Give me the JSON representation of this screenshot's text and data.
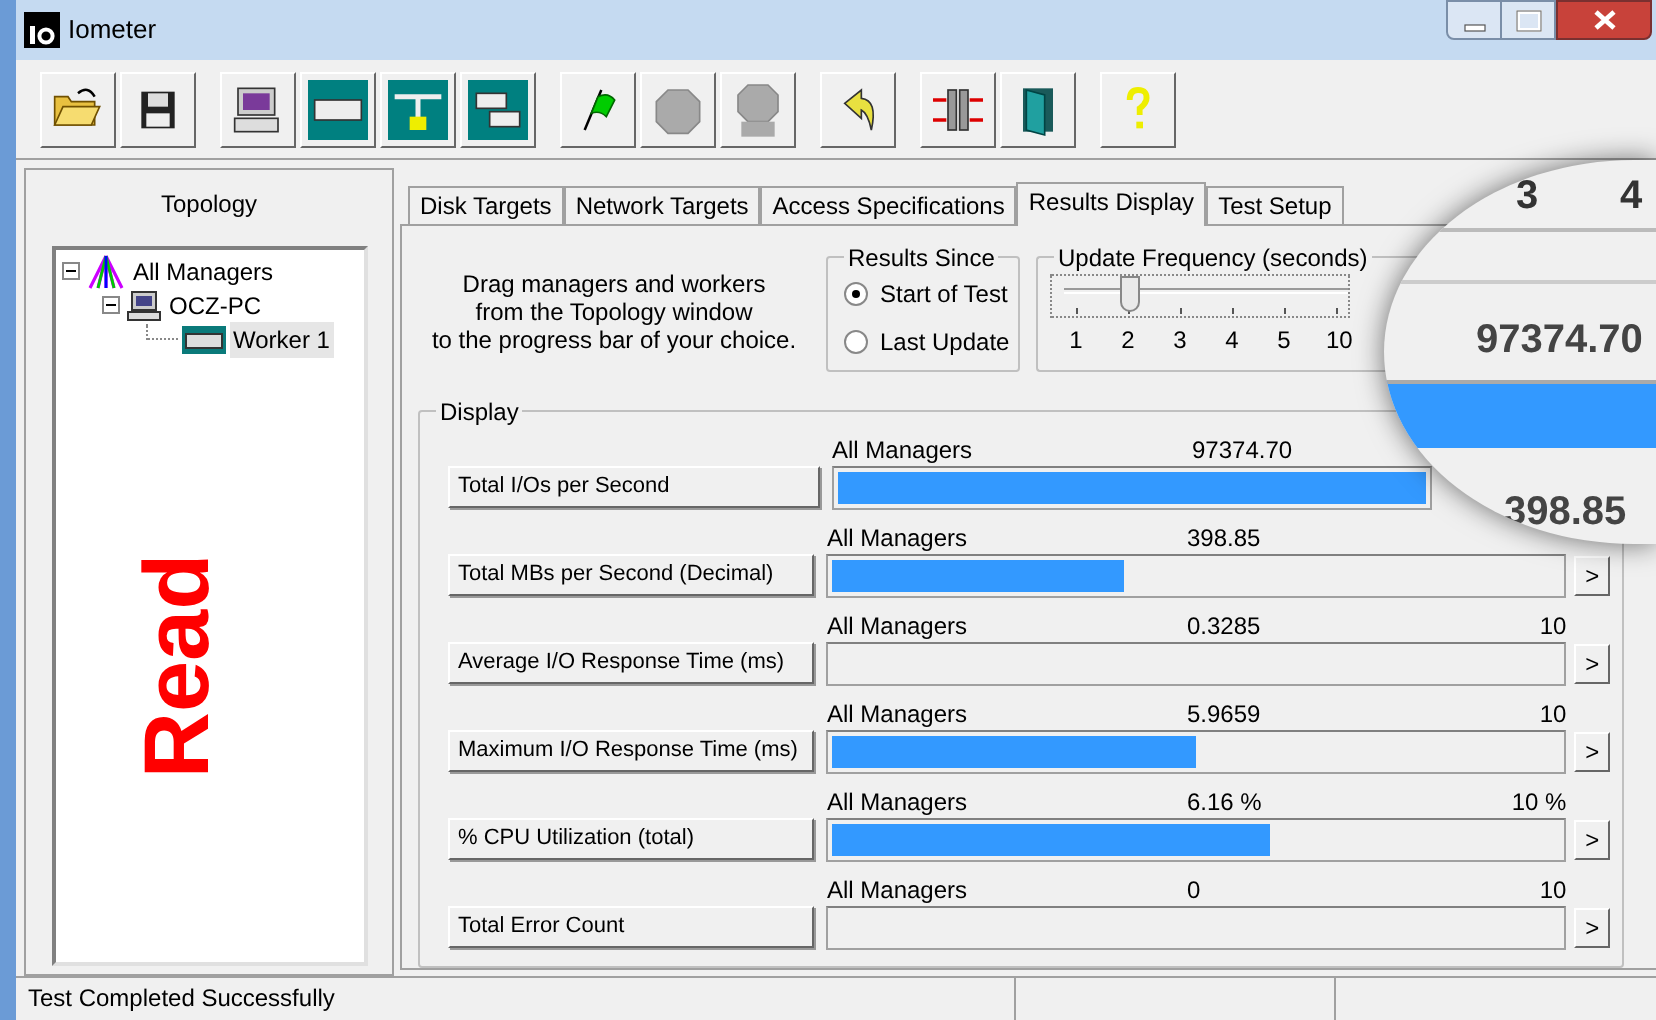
{
  "window": {
    "title": "Iometer"
  },
  "topology": {
    "title": "Topology",
    "tree": [
      {
        "label": "All Managers",
        "kind": "managers",
        "expanded": true,
        "selected": false,
        "children": [
          {
            "label": "OCZ-PC",
            "kind": "manager",
            "expanded": true,
            "selected": false,
            "children": [
              {
                "label": "Worker 1",
                "kind": "worker",
                "selected": true
              }
            ]
          }
        ]
      }
    ]
  },
  "overlay_label": "Read",
  "tabs": [
    {
      "label": "Disk Targets",
      "selected": false
    },
    {
      "label": "Network Targets",
      "selected": false
    },
    {
      "label": "Access Specifications",
      "selected": false
    },
    {
      "label": "Results Display",
      "selected": true
    },
    {
      "label": "Test Setup",
      "selected": false
    }
  ],
  "drag_hint": "Drag managers and workers\nfrom the Topology window\nto the progress bar of your choice.",
  "results_since": {
    "title": "Results Since",
    "options": [
      {
        "label": "Start of Test",
        "selected": true
      },
      {
        "label": "Last Update",
        "selected": false
      }
    ]
  },
  "update_frequency": {
    "title": "Update Frequency (seconds)",
    "ticks": [
      {
        "label": "1",
        "selected": false
      },
      {
        "label": "2",
        "selected": true
      },
      {
        "label": "3",
        "selected": false
      },
      {
        "label": "4",
        "selected": false
      },
      {
        "label": "5",
        "selected": false
      },
      {
        "label": "10",
        "selected": false
      }
    ]
  },
  "display": {
    "title": "Display",
    "rows": [
      {
        "button": "Total I/Os per Second",
        "source": "All Managers",
        "value": "97374.70",
        "level": 1.0
      },
      {
        "button": "Total MBs per Second (Decimal)",
        "source": "All Managers",
        "value": "398.85",
        "level": 0.4,
        "arrow": ">"
      },
      {
        "button": "Average I/O Response Time (ms)",
        "source": "All Managers",
        "value": "0.3285",
        "max": "10",
        "level": 0,
        "arrow": ">"
      },
      {
        "button": "Maximum I/O Response Time (ms)",
        "source": "All Managers",
        "value": "5.9659",
        "max": "10",
        "level": 0.5,
        "arrow": ">"
      },
      {
        "button": "% CPU Utilization (total)",
        "source": "All Managers",
        "value": "6.16 %",
        "max": "10 %",
        "level": 0.6,
        "arrow": ">"
      },
      {
        "button": "Total Error Count",
        "source": "All Managers",
        "value": "0",
        "max": "10",
        "level": 0,
        "arrow": ">"
      }
    ]
  },
  "magnifier": {
    "ticks": [
      "3",
      "4"
    ],
    "readings": [
      "97374.70",
      "398.85"
    ]
  },
  "status_bar": {
    "text": "Test Completed Successfully"
  }
}
